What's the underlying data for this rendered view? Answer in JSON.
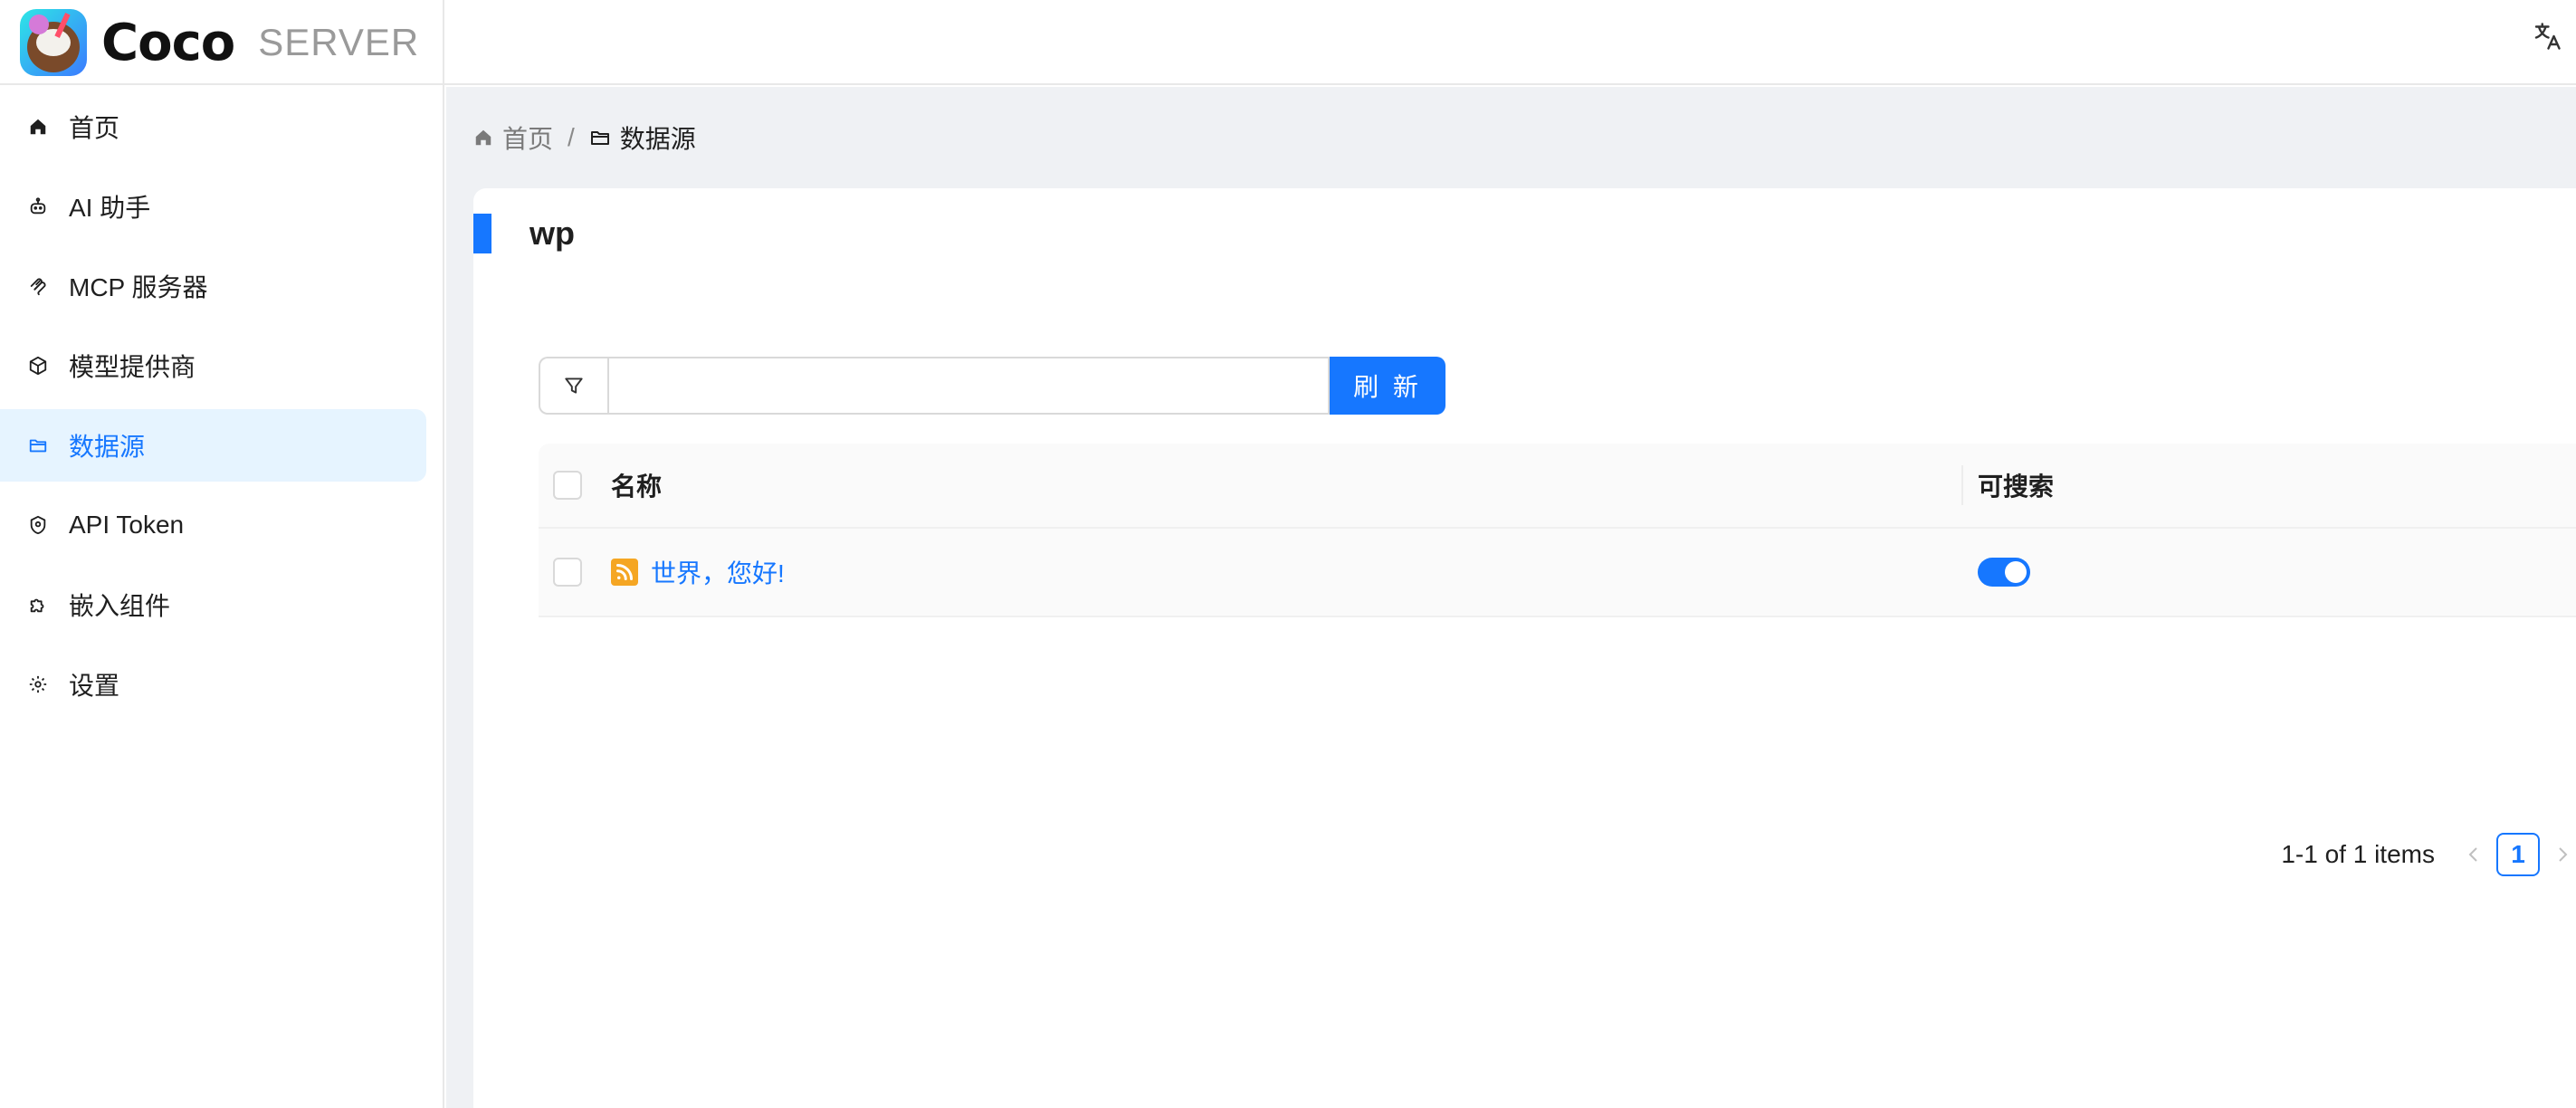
{
  "header": {
    "brand": "Coco",
    "brand_sub": "SERVER",
    "language_icon": "translate-icon"
  },
  "sidebar": {
    "items": [
      {
        "label": "首页",
        "icon": "home-icon"
      },
      {
        "label": "AI 助手",
        "icon": "robot-icon"
      },
      {
        "label": "MCP 服务器",
        "icon": "mcp-icon"
      },
      {
        "label": "模型提供商",
        "icon": "cube-icon"
      },
      {
        "label": "数据源",
        "icon": "folder-icon",
        "active": true
      },
      {
        "label": "API Token",
        "icon": "shield-icon"
      },
      {
        "label": "嵌入组件",
        "icon": "puzzle-icon"
      },
      {
        "label": "设置",
        "icon": "gear-icon"
      }
    ]
  },
  "breadcrumb": {
    "home": "首页",
    "separator": "/",
    "current": "数据源"
  },
  "card": {
    "title": "wp"
  },
  "search": {
    "value": "",
    "placeholder": "",
    "refresh_label": "刷 新"
  },
  "table": {
    "columns": [
      "名称",
      "可搜索"
    ],
    "rows": [
      {
        "name": "世界，您好!",
        "icon": "rss-icon",
        "searchable": true
      }
    ]
  },
  "pagination": {
    "total_text": "1-1 of 1 items",
    "current_page": "1"
  },
  "colors": {
    "accent": "#1677ff",
    "active_bg": "#e6f4ff",
    "main_bg": "#eff1f4",
    "rss": "#f5a623"
  }
}
